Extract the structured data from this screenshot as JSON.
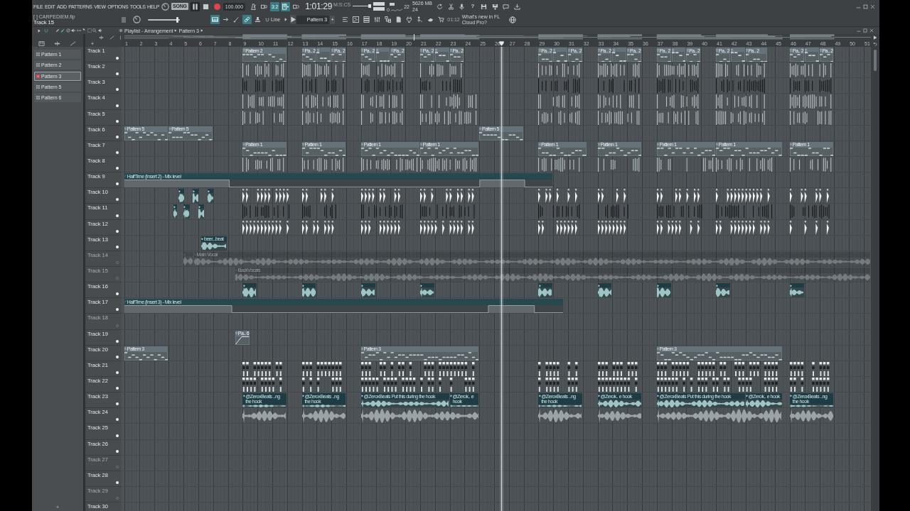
{
  "menu": [
    "FILE",
    "EDIT",
    "ADD",
    "PATTERNS",
    "VIEW",
    "OPTIONS",
    "TOOLS",
    "HELP"
  ],
  "transport": {
    "mode": "SONG",
    "playing": true,
    "tempo": "100.000",
    "time": "1:01:29",
    "time_unit": "M:S:CS"
  },
  "record_toggles": [
    {
      "kind": "metronome",
      "on": false
    },
    {
      "kind": "wait",
      "on": false
    },
    {
      "kind": "countdown",
      "text": "3:2",
      "on": true
    },
    {
      "kind": "step",
      "on": true
    },
    {
      "kind": "loop",
      "on": false
    }
  ],
  "meters": {
    "voices": "22",
    "memory": "5626 MB",
    "cpu": "24"
  },
  "app_buttons": [
    {
      "kind": "refresh"
    },
    {
      "kind": "cut"
    },
    {
      "kind": "mic"
    },
    {
      "kind": "help",
      "text": "?"
    },
    {
      "kind": "save"
    },
    {
      "kind": "export"
    },
    {
      "kind": "chat"
    },
    {
      "kind": "download"
    }
  ],
  "project": {
    "file": "[ ] CARPEDIEM.flp",
    "hint": "Track 15"
  },
  "master_pitch": {
    "level": 0.93
  },
  "tools": [
    {
      "kind": "snapshot",
      "on": true
    },
    {
      "kind": "arrow",
      "on": false
    },
    {
      "kind": "brush",
      "on": false
    },
    {
      "kind": "link",
      "on": true
    },
    {
      "kind": "stamp",
      "on": false
    }
  ],
  "snap": {
    "value": "Line"
  },
  "pattern_selector": {
    "value": "Pattern 3",
    "add": "+"
  },
  "window_buttons": [
    {
      "kind": "playlist"
    },
    {
      "kind": "pianoroll"
    },
    {
      "kind": "rack"
    },
    {
      "kind": "mixer"
    },
    {
      "kind": "browser"
    },
    {
      "kind": "document"
    },
    {
      "kind": "plugin"
    },
    {
      "kind": "tutor"
    },
    {
      "kind": "touch"
    },
    {
      "kind": "shop"
    }
  ],
  "news": {
    "time": "01:12",
    "text": "What's new in FL Cloud Pro?"
  },
  "playlist": {
    "breadcrumb": [
      "Playlist - Arrangement",
      "Pattern 3"
    ],
    "toolbar": [
      {
        "kind": "snap",
        "on": true
      },
      {
        "kind": "draw",
        "on": false
      },
      {
        "kind": "paint",
        "on": true
      },
      {
        "kind": "delete",
        "on": false
      },
      {
        "kind": "mute",
        "on": false
      },
      {
        "kind": "slip",
        "on": false
      },
      {
        "kind": "slice",
        "on": false
      },
      {
        "kind": "select",
        "on": false
      },
      {
        "kind": "zoom",
        "on": false
      },
      {
        "kind": "playback",
        "on": false
      }
    ],
    "add_track": "+",
    "picker": [
      {
        "label": "Pattern 1",
        "selected": false
      },
      {
        "label": "Pattern 2",
        "selected": false
      },
      {
        "label": "Pattern 3",
        "selected": true
      },
      {
        "label": "Pattern 5",
        "selected": false
      },
      {
        "label": "Pattern 6",
        "selected": false
      }
    ],
    "picker_add": "+",
    "ruler": [
      "1",
      "2",
      "3",
      "4",
      "5",
      "6",
      "7",
      "8",
      "9",
      "10",
      "11",
      "12",
      "13",
      "14",
      "15",
      "16",
      "17",
      "18",
      "19",
      "20",
      "21",
      "22",
      "23",
      "24",
      "25",
      "26",
      "27",
      "28",
      "29",
      "30",
      "31",
      "32",
      "33",
      "34",
      "35",
      "36",
      "37",
      "38",
      "39",
      "40",
      "41",
      "42",
      "43",
      "44",
      "45",
      "46",
      "47",
      "48",
      "49",
      "50",
      "51"
    ],
    "tracks": [
      {
        "name": "Track 1",
        "muted": false,
        "clips": [
          {
            "kind": "pattern",
            "label": "Pattern 2"
          },
          {
            "kind": "pattern",
            "label": "Pa.. 2"
          },
          {
            "kind": "pattern"
          },
          {
            "kind": "pattern",
            "label": "Pa.. 2"
          },
          {
            "kind": "pattern",
            "label": "Pa.. 2"
          },
          {
            "kind": "pattern"
          },
          {
            "kind": "pattern",
            "label": "Pa.. 2"
          },
          {
            "kind": "pattern",
            "label": "Pa.. 2"
          },
          {
            "kind": "pattern"
          },
          {
            "kind": "pattern",
            "label": "Pa.. 2"
          },
          {
            "kind": "pattern",
            "label": "Pa.. 2"
          },
          {
            "kind": "pattern"
          },
          {
            "kind": "pattern",
            "label": "Pa.. 2"
          },
          {
            "kind": "pattern",
            "label": "Pa.. 2"
          },
          {
            "kind": "pattern"
          },
          {
            "kind": "pattern",
            "label": "Pa.. 2"
          },
          {
            "kind": "pattern",
            "label": "Pa.. 2"
          },
          {
            "kind": "pattern"
          },
          {
            "kind": "pattern",
            "label": "Pa.. 2"
          },
          {
            "kind": "pattern",
            "label": "Pa.. 2"
          },
          {
            "kind": "pattern"
          },
          {
            "kind": "pattern",
            "label": "Pa.. 2"
          },
          {
            "kind": "pattern",
            "label": "Pa.. 2"
          },
          {
            "kind": "pattern"
          },
          {
            "kind": "pattern",
            "label": "Pa.. 2"
          }
        ]
      },
      {
        "name": "Track 2",
        "muted": false,
        "clips": [
          {
            "kind": "hits"
          },
          {
            "kind": "hits"
          },
          {
            "kind": "hits"
          },
          {
            "kind": "hits"
          },
          {
            "kind": "hits"
          },
          {
            "kind": "hits"
          },
          {
            "kind": "hits"
          },
          {
            "kind": "hits"
          },
          {
            "kind": "hits"
          }
        ]
      },
      {
        "name": "Track 3",
        "muted": false,
        "clips": [
          {
            "kind": "beats"
          },
          {
            "kind": "beats"
          },
          {
            "kind": "beats"
          },
          {
            "kind": "beats"
          },
          {
            "kind": "beats"
          },
          {
            "kind": "beats"
          },
          {
            "kind": "beats"
          },
          {
            "kind": "beats"
          },
          {
            "kind": "beats"
          }
        ]
      },
      {
        "name": "Track 4",
        "muted": false,
        "clips": [
          {
            "kind": "hits"
          },
          {
            "kind": "hits"
          },
          {
            "kind": "hits"
          },
          {
            "kind": "hits"
          },
          {
            "kind": "hits"
          },
          {
            "kind": "hits"
          },
          {
            "kind": "hits"
          },
          {
            "kind": "hits"
          },
          {
            "kind": "hits"
          }
        ]
      },
      {
        "name": "Track 5",
        "muted": false,
        "clips": [
          {
            "kind": "hits"
          },
          {
            "kind": "hits"
          },
          {
            "kind": "hits"
          },
          {
            "kind": "hits"
          },
          {
            "kind": "hits"
          },
          {
            "kind": "hits"
          },
          {
            "kind": "hits"
          },
          {
            "kind": "hits"
          },
          {
            "kind": "hits"
          }
        ]
      },
      {
        "name": "Track 6",
        "muted": false,
        "clips": [
          {
            "kind": "pattern",
            "label": "Pattern 5"
          },
          {
            "kind": "pattern",
            "label": "Pattern 5"
          },
          {
            "kind": "pattern",
            "label": "Pattern 5"
          }
        ]
      },
      {
        "name": "Track 7",
        "muted": false,
        "clips": [
          {
            "kind": "pattern",
            "label": "Pattern 1"
          },
          {
            "kind": "pattern",
            "label": "Pattern 1"
          },
          {
            "kind": "pattern",
            "label": "Pattern 1"
          },
          {
            "kind": "pattern",
            "label": "Pattern 1"
          },
          {
            "kind": "pattern",
            "label": "Pattern 1"
          },
          {
            "kind": "pattern",
            "label": "Pattern 1"
          },
          {
            "kind": "pattern",
            "label": "Pattern 1"
          },
          {
            "kind": "pattern",
            "label": "Pattern 1"
          },
          {
            "kind": "pattern",
            "label": "Pattern 1"
          }
        ]
      },
      {
        "name": "Track 8",
        "muted": false,
        "clips": [
          {
            "kind": "hits"
          },
          {
            "kind": "hits"
          },
          {
            "kind": "hits"
          },
          {
            "kind": "hits"
          },
          {
            "kind": "hits"
          },
          {
            "kind": "hits"
          },
          {
            "kind": "hits"
          },
          {
            "kind": "hits"
          },
          {
            "kind": "hits"
          }
        ]
      },
      {
        "name": "Track 9",
        "muted": false,
        "clips": [
          {
            "kind": "automation",
            "label": "HalfTime (Insert 2) - Mix level"
          }
        ]
      },
      {
        "name": "Track 10",
        "muted": false,
        "clips": [
          {
            "kind": "sample"
          },
          {
            "kind": "sample"
          },
          {
            "kind": "sample"
          },
          {
            "kind": "shots"
          },
          {
            "kind": "shots"
          },
          {
            "kind": "shots"
          },
          {
            "kind": "shots"
          },
          {
            "kind": "shots"
          },
          {
            "kind": "shots"
          },
          {
            "kind": "shots"
          },
          {
            "kind": "shots"
          },
          {
            "kind": "shots"
          }
        ]
      },
      {
        "name": "Track 11",
        "muted": false,
        "clips": [
          {
            "kind": "sample"
          },
          {
            "kind": "sample"
          },
          {
            "kind": "sample"
          },
          {
            "kind": "beats"
          },
          {
            "kind": "beats"
          },
          {
            "kind": "beats"
          },
          {
            "kind": "beats"
          },
          {
            "kind": "beats"
          },
          {
            "kind": "beats"
          },
          {
            "kind": "beats"
          },
          {
            "kind": "beats"
          },
          {
            "kind": "beats"
          }
        ]
      },
      {
        "name": "Track 12",
        "muted": false,
        "clips": [
          {
            "kind": "shots"
          },
          {
            "kind": "shots"
          },
          {
            "kind": "shots"
          },
          {
            "kind": "shots"
          },
          {
            "kind": "shots"
          },
          {
            "kind": "shots"
          },
          {
            "kind": "shots"
          },
          {
            "kind": "shots"
          },
          {
            "kind": "shots"
          }
        ]
      },
      {
        "name": "Track 13",
        "muted": false,
        "clips": [
          {
            "kind": "sample",
            "label": "beer...beat"
          }
        ]
      },
      {
        "name": "Track 14",
        "muted": true,
        "clips": [
          {
            "kind": "audio"
          },
          {
            "kind": "audio",
            "label": "Main Vocal"
          }
        ]
      },
      {
        "name": "Track 15",
        "muted": true,
        "clips": [
          {
            "kind": "audio",
            "label": "BackVocals"
          }
        ]
      },
      {
        "name": "Track 16",
        "muted": false,
        "clips": [
          {
            "kind": "sample"
          },
          {
            "kind": "sample"
          },
          {
            "kind": "sample"
          },
          {
            "kind": "sample"
          },
          {
            "kind": "sample"
          },
          {
            "kind": "sample"
          },
          {
            "kind": "sample"
          },
          {
            "kind": "sample"
          },
          {
            "kind": "sample"
          }
        ]
      },
      {
        "name": "Track 17",
        "muted": false,
        "clips": [
          {
            "kind": "automation",
            "label": "HalfTime (Insert 3) - Mix level"
          }
        ]
      },
      {
        "name": "Track 18",
        "muted": true
      },
      {
        "name": "Track 19",
        "muted": false,
        "clips": [
          {
            "kind": "curve",
            "label": "Pa.. 6"
          }
        ]
      },
      {
        "name": "Track 20",
        "muted": false,
        "clips": [
          {
            "kind": "pattern",
            "label": "Pattern 3"
          },
          {
            "kind": "pattern",
            "label": "Pattern 3"
          },
          {
            "kind": "pattern",
            "label": "Pattern 3"
          }
        ]
      },
      {
        "name": "Track 21",
        "muted": false,
        "clips": [
          {
            "kind": "blocks"
          },
          {
            "kind": "blocks"
          },
          {
            "kind": "blocks"
          },
          {
            "kind": "blocks"
          },
          {
            "kind": "blocks"
          },
          {
            "kind": "blocks"
          },
          {
            "kind": "blocks"
          }
        ]
      },
      {
        "name": "Track 22",
        "muted": false,
        "clips": [
          {
            "kind": "blocks"
          },
          {
            "kind": "blocks"
          },
          {
            "kind": "blocks"
          },
          {
            "kind": "blocks"
          },
          {
            "kind": "blocks"
          },
          {
            "kind": "blocks"
          },
          {
            "kind": "blocks"
          }
        ]
      },
      {
        "name": "Track 23",
        "muted": false,
        "clips": [
          {
            "kind": "sample",
            "label": "@ZeroxBeats ..ng the hook"
          },
          {
            "kind": "sample",
            "label": "@ZeroxBeats ..ng the hook"
          },
          {
            "kind": "sample",
            "label": "@ZeroxBeats Put this during the hook"
          },
          {
            "kind": "sample",
            "label": "@Zerok.. e hook"
          },
          {
            "kind": "sample",
            "label": "@ZeroxBeats ..ng the hook"
          },
          {
            "kind": "sample",
            "label": "@Zerok.. e hook"
          },
          {
            "kind": "sample",
            "label": "@ZeroxBeats Put this during the hook"
          },
          {
            "kind": "sample",
            "label": "@Zerok.. e hook"
          },
          {
            "kind": "sample",
            "label": "@ZeroxBeats ..ng the hook"
          }
        ]
      },
      {
        "name": "Track 24",
        "muted": false,
        "clips": [
          {
            "kind": "wave"
          },
          {
            "kind": "wave"
          },
          {
            "kind": "wave"
          },
          {
            "kind": "wave"
          },
          {
            "kind": "wave"
          },
          {
            "kind": "wave"
          },
          {
            "kind": "wave"
          }
        ]
      },
      {
        "name": "Track 25",
        "muted": false
      },
      {
        "name": "Track 26",
        "muted": false
      },
      {
        "name": "Track 27",
        "muted": true
      },
      {
        "name": "Track 28",
        "muted": false
      },
      {
        "name": "Track 29",
        "muted": true
      },
      {
        "name": "Track 30"
      }
    ]
  }
}
